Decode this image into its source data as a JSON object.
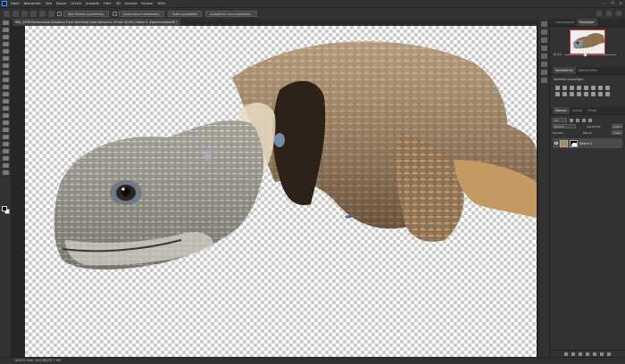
{
  "menubar": {
    "items": [
      "Datei",
      "Bearbeiten",
      "Bild",
      "Ebene",
      "Schrift",
      "Auswahl",
      "Filter",
      "3D",
      "Ansicht",
      "Fenster",
      "Hilfe"
    ],
    "controls": [
      "–",
      "❐",
      "✕"
    ]
  },
  "options": {
    "buttons": [
      "Alle Ebenen aufnehmen",
      "Automatisch verbessern",
      "Motiv auswählen",
      "Auswählen und maskieren..."
    ]
  },
  "document": {
    "tab_title": "IMG_1990 Deutschland Bamberg Trans Bamberg fotos Naturlich Gif bei 16,4% (Ebene 0, Ebenenmaske/8) *"
  },
  "status": {
    "text": "16,45%     Dok: 34,0 MB/76,7 MB"
  },
  "panels": {
    "top_tabs": [
      "Histogramm",
      "Navigator"
    ],
    "active_top": "Navigator",
    "zoom": "16,4%",
    "mid_tabs": [
      "Korrekturen",
      "Bibliotheken"
    ],
    "adjust_label": "Korrektur hinzufügen",
    "layer_tabs": [
      "Ebenen",
      "Kanäle",
      "Pfade"
    ],
    "kind_label": "Art",
    "blend_mode": "Normal",
    "opacity_label": "Deckkraft:",
    "opacity": "100%",
    "lock_label": "Fixieren:",
    "fill_label": "Fläche:",
    "fill": "100%",
    "layers": [
      {
        "name": "Ebene 0"
      }
    ]
  },
  "colors": {
    "foreground": "#000000",
    "background": "#ffffff",
    "accent": "#31a8ff"
  }
}
